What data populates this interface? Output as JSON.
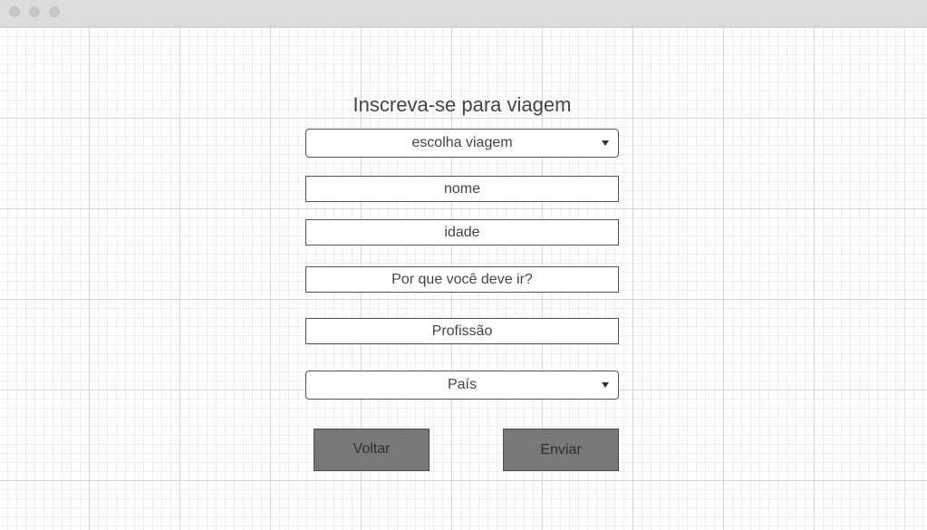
{
  "form": {
    "title": "Inscreva-se para viagem",
    "trip_select": {
      "value": "escolha viagem"
    },
    "name_field": {
      "value": "nome"
    },
    "age_field": {
      "value": "idade"
    },
    "why_field": {
      "value": "Por que você deve ir?"
    },
    "profession_field": {
      "value": "Profissão"
    },
    "country_select": {
      "value": "País"
    },
    "back_button": {
      "label": "Voltar"
    },
    "submit_button": {
      "label": "Enviar"
    }
  },
  "icons": {
    "select_arrow": "chevron-down-icon",
    "window_controls": [
      "window-dot-icon",
      "window-dot-icon",
      "window-dot-icon"
    ]
  },
  "colors": {
    "button_fill": "#787878",
    "field_border": "#555555",
    "titlebar": "#dcdcdc",
    "text": "#444444"
  }
}
